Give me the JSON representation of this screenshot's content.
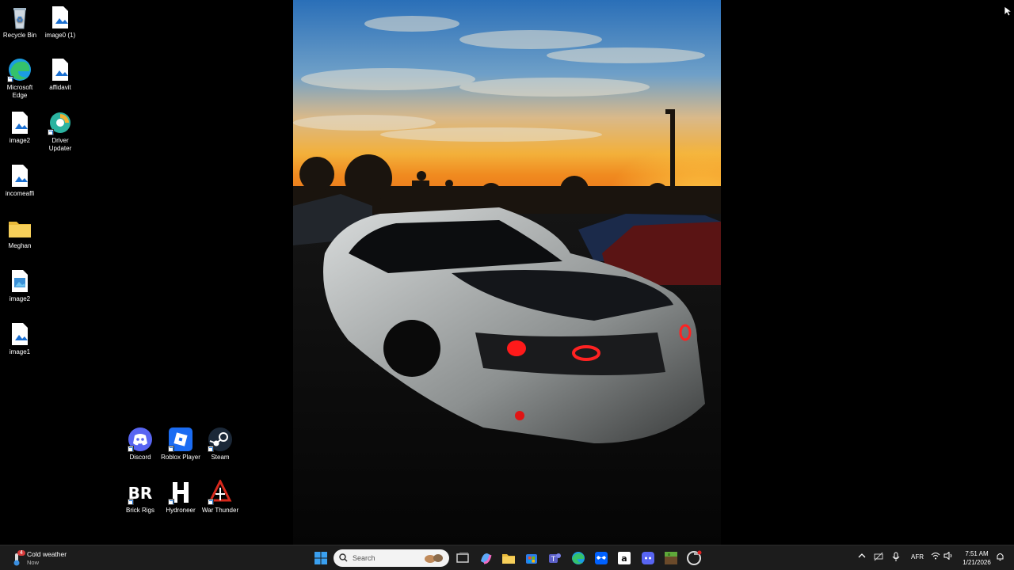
{
  "desktop": {
    "icons": [
      {
        "label": "Recycle Bin",
        "icon": "recycle-bin-icon"
      },
      {
        "label": "image0 (1)",
        "icon": "image-file-icon"
      },
      {
        "label": "Microsoft Edge",
        "icon": "edge-icon"
      },
      {
        "label": "affidavit",
        "icon": "image-file-icon"
      },
      {
        "label": "image2",
        "icon": "image-file-icon"
      },
      {
        "label": "Driver Updater",
        "icon": "driver-updater-icon"
      },
      {
        "label": "incomeaffi",
        "icon": "image-file-icon"
      },
      {
        "label": "Meghan",
        "icon": "folder-icon"
      },
      {
        "label": "image2",
        "icon": "image-file-icon"
      },
      {
        "label": "image1",
        "icon": "image-file-icon"
      },
      {
        "label": "Discord",
        "icon": "discord-icon"
      },
      {
        "label": "Roblox Player",
        "icon": "roblox-icon"
      },
      {
        "label": "Steam",
        "icon": "steam-icon"
      },
      {
        "label": "Brick Rigs",
        "icon": "brick-rigs-icon"
      },
      {
        "label": "Hydroneer",
        "icon": "hydroneer-icon"
      },
      {
        "label": "War Thunder",
        "icon": "war-thunder-icon"
      }
    ]
  },
  "taskbar": {
    "weather": {
      "title": "Cold weather",
      "subtitle": "Now",
      "badge": "4"
    },
    "search": {
      "placeholder": "Search"
    },
    "apps": [
      "start-icon",
      "task-view-icon",
      "copilot-icon",
      "file-explorer-icon",
      "microsoft-store-icon",
      "teams-icon",
      "edge-icon",
      "dropbox-icon",
      "amazon-icon",
      "discord-icon",
      "minecraft-icon",
      "chrome-icon"
    ],
    "tray": {
      "language": "AFR"
    },
    "clock": {
      "time": "7:51 AM",
      "date": "1/21/2026"
    }
  },
  "colors": {
    "taskbar": "#1c1c1c",
    "accent": "#1a6fd1",
    "discord": "#5865f2",
    "roblox": "#1b6cf2"
  }
}
